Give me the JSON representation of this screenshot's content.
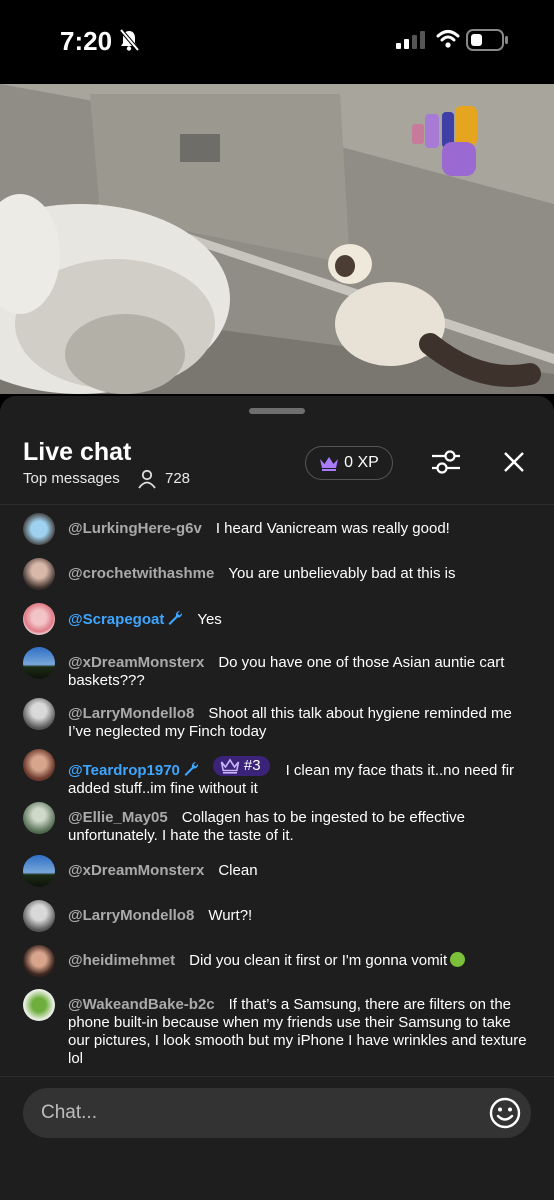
{
  "status_bar": {
    "time": "7:20"
  },
  "chat": {
    "title": "Live chat",
    "mode": "Top messages",
    "viewer_count": "728",
    "xp_label": "0 XP",
    "input_placeholder": "Chat...",
    "messages": [
      {
        "author": "@LurkingHere-g6v",
        "text": "I heard Vanicream was really good!"
      },
      {
        "author": "@crochetwithashme",
        "text": "You are unbelievably bad at this is"
      },
      {
        "author": "@Scrapegoat",
        "text": "Yes",
        "moderator": true
      },
      {
        "author": "@xDreamMonsterx",
        "text": "Do you have one of those Asian auntie cart baskets???"
      },
      {
        "author": "@LarryMondello8",
        "text": "Shoot all this talk about hygiene reminded me I’ve neglected my Finch today"
      },
      {
        "author": "@Teardrop1970",
        "text": "I clean my face thats it..no need fir added stuff..im fine without it",
        "moderator": true,
        "rank": "#3"
      },
      {
        "author": "@Ellie_May05",
        "text": "Collagen has to be ingested to be effective unfortunately. I hate the taste of it."
      },
      {
        "author": "@xDreamMonsterx",
        "text": "Clean"
      },
      {
        "author": "@LarryMondello8",
        "text": "Wurt?!"
      },
      {
        "author": "@heidimehmet",
        "text": "Did you clean it first or I'm gonna vomit",
        "emoji": "nauseated-face-icon"
      },
      {
        "author": "@WakeandBake-b2c",
        "text": "If that’s a Samsung, there are filters on the phone built-in because when my friends use their Samsung to take our pictures, I look smooth but my iPhone I have wrinkles and texture lol"
      }
    ]
  },
  "colors": {
    "panel_bg": "#1e1e1e",
    "moderator_name": "#3ea6ff",
    "author_name": "#aaaaaa",
    "crown_purple": "#a97cff",
    "rank_badge_bg": "#3b2379",
    "input_bg": "#333333"
  }
}
